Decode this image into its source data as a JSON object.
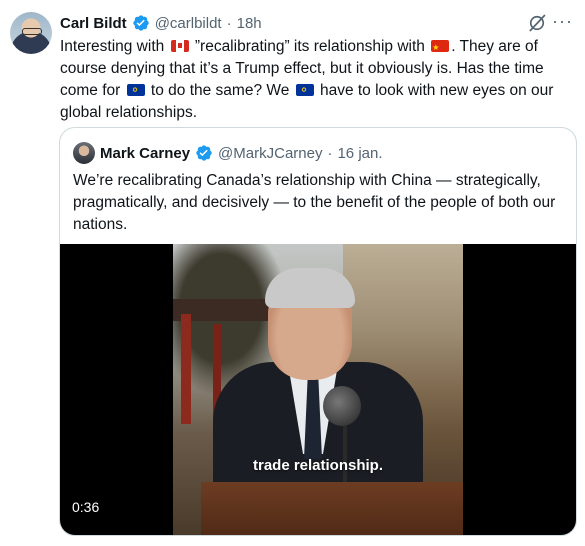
{
  "author": {
    "name": "Carl Bildt",
    "handle": "@carlbildt",
    "separator": "·",
    "time": "18h",
    "avatar_icon": "avatar-photo"
  },
  "tweet": {
    "segments": [
      "Interesting with ",
      "flag-canada",
      " ”recalibrating” its relationship with ",
      "flag-china",
      ". They are of course denying that it’s a Trump effect, but it obviously is. Has the time come for ",
      "flag-eu",
      " to do the same? We ",
      "flag-eu",
      " have to look with new eyes on our global relationships."
    ],
    "text_part_1": "Interesting with ",
    "text_part_2": " ”recalibrating” its relationship with ",
    "text_part_3": ". They are of course denying that it’s a Trump effect, but it obviously is. Has the time come for ",
    "text_part_4": " to do the same? We ",
    "text_part_5": " have to look with new eyes on our global relationships."
  },
  "quoted": {
    "name": "Mark Carney",
    "handle": "@MarkJCarney",
    "separator": "·",
    "time": "16 jan.",
    "text": "We’re recalibrating Canada’s relationship with China — strategically, pragmatically, and decisively — to the benefit of the people of both our nations.",
    "video": {
      "caption": "trade relationship.",
      "duration": "0:36"
    }
  },
  "icons": {
    "verified": "verified-badge-icon",
    "grok": "grok-icon",
    "more": "more-options-icon"
  },
  "colors": {
    "text": "#0f1419",
    "muted": "#536471",
    "verified": "#1d9bf0",
    "border": "#cfd9de"
  },
  "more_glyph": "···"
}
